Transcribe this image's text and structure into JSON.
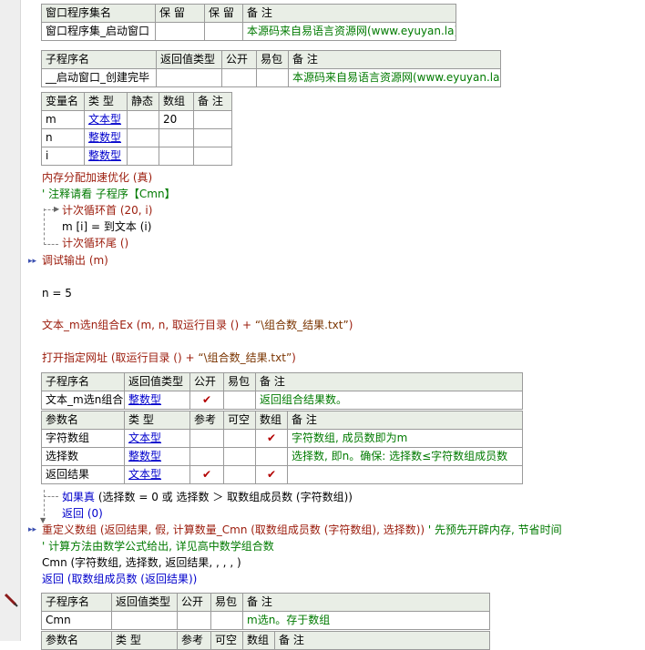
{
  "t1": {
    "head": [
      "窗口程序集名",
      "保 留",
      "保 留",
      "备 注"
    ],
    "row": [
      "窗口程序集_启动窗口",
      "",
      "",
      "本源码来自易语言资源网(www.eyuyan.la)"
    ]
  },
  "t2": {
    "head": [
      "子程序名",
      "返回值类型",
      "公开",
      "易包",
      "备 注"
    ],
    "row": [
      "__启动窗口_创建完毕",
      "",
      "",
      "",
      "本源码来自易语言资源网(www.eyuyan.la)"
    ]
  },
  "t3": {
    "head": [
      "变量名",
      "类 型",
      "静态",
      "数组",
      "备 注"
    ],
    "rows": [
      [
        "m",
        "文本型",
        "",
        "20",
        ""
      ],
      [
        "n",
        "整数型",
        "",
        "",
        ""
      ],
      [
        "i",
        "整数型",
        "",
        "",
        ""
      ]
    ]
  },
  "code1": {
    "l1": "内存分配加速优化 (真)",
    "l2": "' 注释请看 子程序【Cmn】",
    "l3": "计次循环首 (20, i)",
    "l4": "m [i] = 到文本 (i)",
    "l5": "计次循环尾 ()",
    "l6": "调试输出 (m)",
    "l7": "n = 5",
    "l8a": "文本_m选n组合Ex (m, n, 取运行目录 () + ",
    "l8b": "“\\组合数_结果.txt”",
    "l8c": ")",
    "l9a": "打开指定网址 (取运行目录 () + ",
    "l9b": "“\\组合数_结果.txt”",
    "l9c": ")"
  },
  "t4": {
    "head": [
      "子程序名",
      "返回值类型",
      "公开",
      "易包",
      "备 注"
    ],
    "row": [
      "文本_m选n组合",
      "整数型",
      "✔",
      "",
      "返回组合结果数。"
    ],
    "phead": [
      "参数名",
      "类 型",
      "参考",
      "可空",
      "数组",
      "备 注"
    ],
    "prows": [
      [
        "字符数组",
        "文本型",
        "",
        "",
        "✔",
        "字符数组, 成员数即为m"
      ],
      [
        "选择数",
        "整数型",
        "",
        "",
        "",
        "选择数, 即n。确保: 选择数≤字符数组成员数"
      ],
      [
        "返回结果",
        "文本型",
        "✔",
        "",
        "✔",
        ""
      ]
    ]
  },
  "code2": {
    "l1a": "如果真",
    "l1b": " (选择数 = 0 或 选择数 ＞ 取数组成员数 (字符数组))",
    "l2": "返回 (0)",
    "l3a": "重定义数组 (返回结果, 假, 计算数量_Cmn (取数组成员数 (字符数组), 选择数)) ",
    "l3b": "' 先预先开辟内存, 节省时间",
    "l4": "' 计算方法由数学公式给出, 详见高中数学组合数",
    "l5": "Cmn (字符数组, 选择数, 返回结果, , , , )",
    "l6": "返回 (取数组成员数 (返回结果))"
  },
  "t5": {
    "head": [
      "子程序名",
      "返回值类型",
      "公开",
      "易包",
      "备 注"
    ],
    "row": [
      "Cmn",
      "",
      "",
      "",
      "m选n。存于数组"
    ],
    "phead": [
      "参数名",
      "类 型",
      "参考",
      "可空",
      "数组",
      "备 注"
    ]
  },
  "icons": {
    "breakpoint": "arrow-marker-icon",
    "edit": "pencil-icon"
  }
}
